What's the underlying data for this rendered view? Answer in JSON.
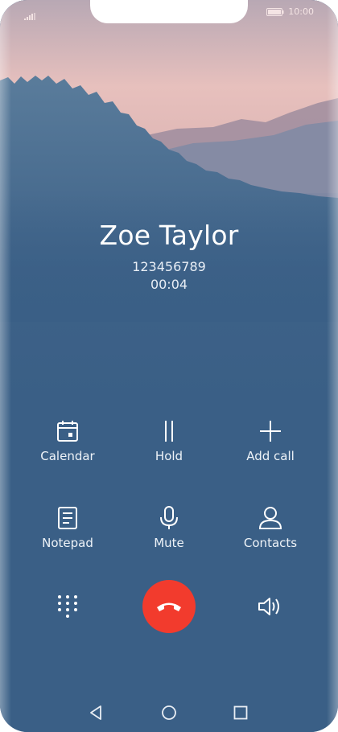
{
  "status": {
    "time": "10:00"
  },
  "call": {
    "name": "Zoe Taylor",
    "number": "123456789",
    "duration": "00:04"
  },
  "actions": [
    {
      "label": "Calendar",
      "icon": "calendar-icon"
    },
    {
      "label": "Hold",
      "icon": "pause-icon"
    },
    {
      "label": "Add call",
      "icon": "plus-icon"
    },
    {
      "label": "Notepad",
      "icon": "notepad-icon"
    },
    {
      "label": "Mute",
      "icon": "microphone-icon"
    },
    {
      "label": "Contacts",
      "icon": "contact-icon"
    }
  ],
  "controls": {
    "keypad_icon": "dialpad-icon",
    "end_call_icon": "end-call-icon",
    "end_call_color": "#f23b2d",
    "speaker_icon": "speaker-icon"
  },
  "navbar": [
    "back-icon",
    "home-icon",
    "recents-icon"
  ]
}
